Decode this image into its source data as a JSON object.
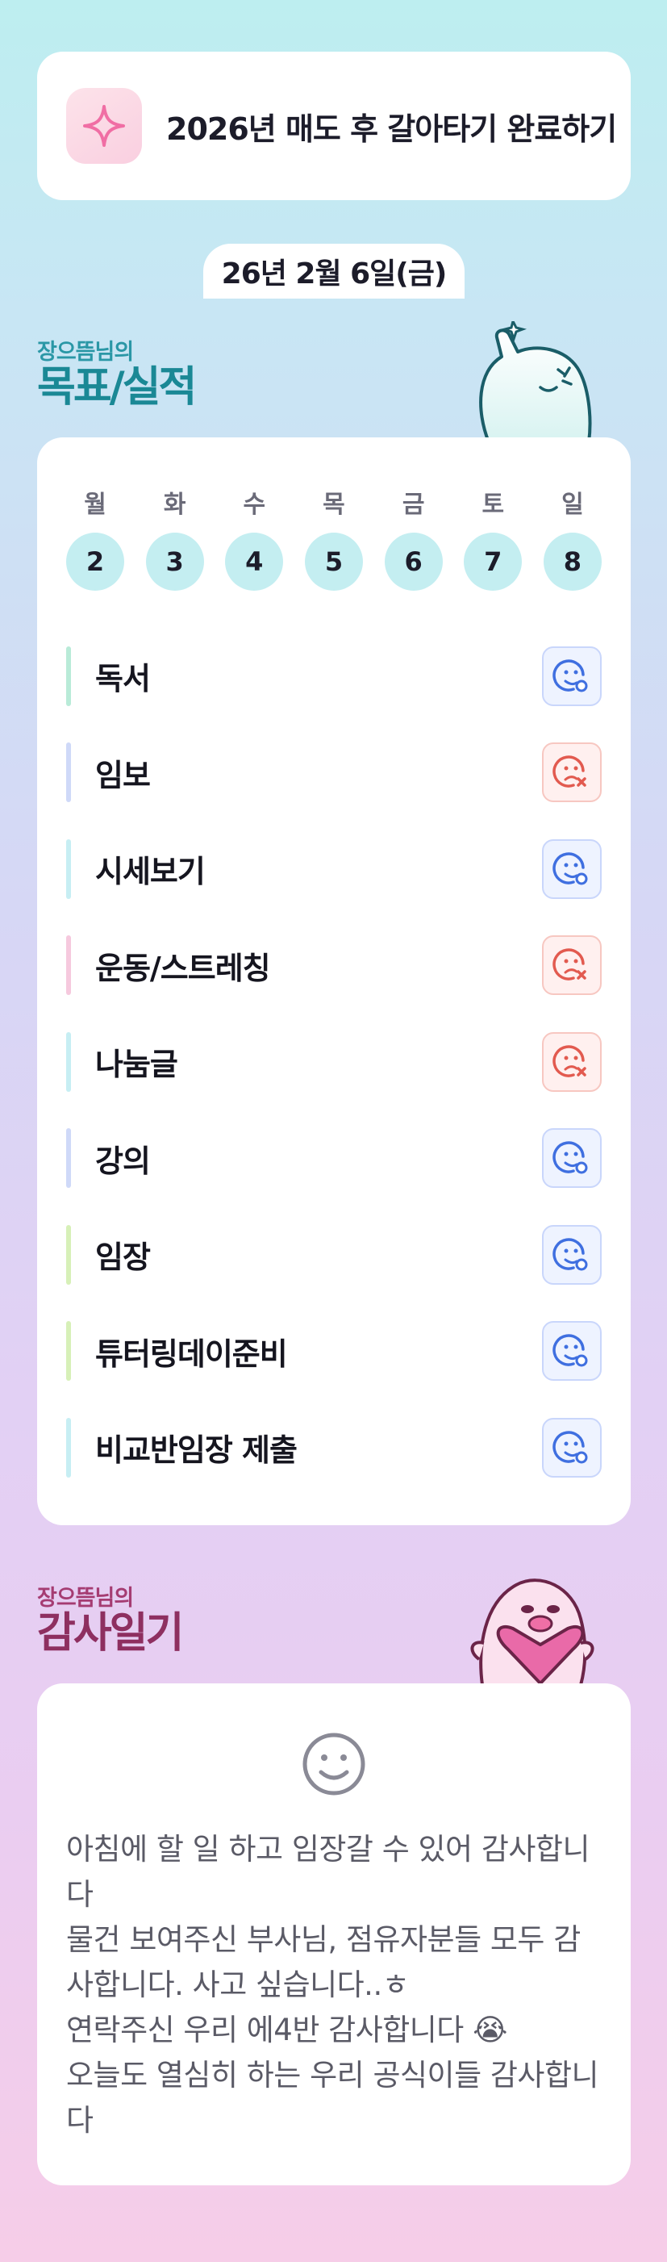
{
  "goal": {
    "text": "2026년 매도 후 갈아타기 완료하기",
    "icon": "sparkle-icon"
  },
  "date": "26년 2월 6일(금)",
  "plan_section": {
    "subtitle": "장으뜸님의",
    "title": "목표/실적"
  },
  "week": {
    "days": [
      "월",
      "화",
      "수",
      "목",
      "금",
      "토",
      "일"
    ],
    "dates": [
      "2",
      "3",
      "4",
      "5",
      "6",
      "7",
      "8"
    ]
  },
  "tasks": [
    {
      "label": "독서",
      "status": "done",
      "bar": "#b9ebd8"
    },
    {
      "label": "임보",
      "status": "missed",
      "bar": "#cfd9f8"
    },
    {
      "label": "시세보기",
      "status": "done",
      "bar": "#c7eef3"
    },
    {
      "label": "운동/스트레칭",
      "status": "missed",
      "bar": "#f6c9de"
    },
    {
      "label": "나눔글",
      "status": "missed",
      "bar": "#c7eef3"
    },
    {
      "label": "강의",
      "status": "done",
      "bar": "#cfd9f8"
    },
    {
      "label": "임장",
      "status": "done",
      "bar": "#d7f0b8"
    },
    {
      "label": "튜터링데이준비",
      "status": "done",
      "bar": "#d7f0b8"
    },
    {
      "label": "비교반임장 제출",
      "status": "done",
      "bar": "#c7eef3"
    }
  ],
  "diary_section": {
    "subtitle": "장으뜸님의",
    "title": "감사일기"
  },
  "diary": {
    "mood_icon": "smiley-face-icon",
    "text": "아침에 할 일 하고 임장갈 수 있어 감사합니다\n물건 보여주신 부사님, 점유자분들 모두 감사합니다. 사고 싶습니다..ㅎ\n연락주신 우리 에4반 감사합니다 😭\n오늘도 열심히 하는 우리 공식이들 감사합니다"
  },
  "colors": {
    "done": "#3f6fe0",
    "missed": "#e25a4f",
    "day_circle": "#c4eef1"
  }
}
